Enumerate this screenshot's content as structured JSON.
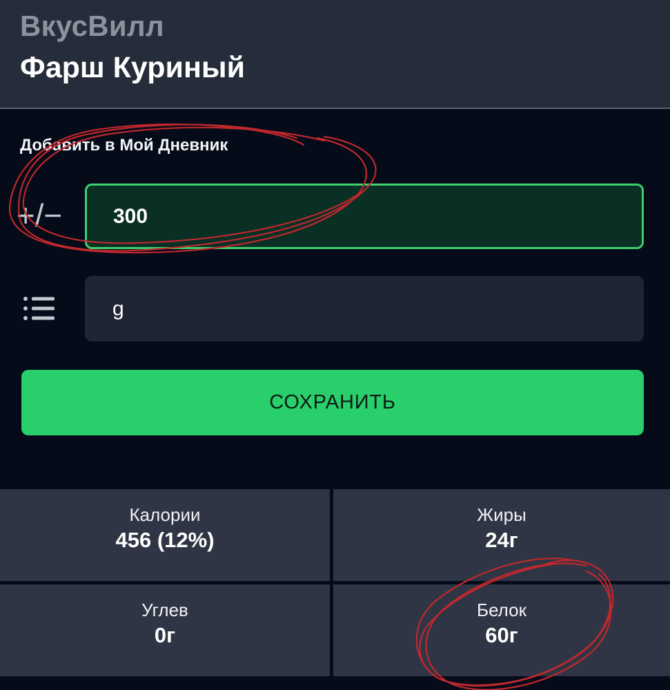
{
  "header": {
    "brand": "ВкусВилл",
    "title": "Фарш Куриный"
  },
  "add_section": {
    "label": "Добавить в Мой Дневник",
    "quantity_icon_text": "+/−",
    "quantity_value": "300",
    "unit_icon": "list-icon",
    "unit_value": "g",
    "save_label": "СОХРАНИТЬ"
  },
  "nutrition": [
    {
      "label": "Калории",
      "value": "456 (12%)"
    },
    {
      "label": "Жиры",
      "value": "24г"
    },
    {
      "label": "Углев",
      "value": "0г"
    },
    {
      "label": "Белок",
      "value": "60г"
    }
  ],
  "colors": {
    "header_bg": "#262d3a",
    "page_bg": "#050b18",
    "accent_green": "#29cf6b",
    "qty_field_bg": "#0a2f25",
    "annotation_red": "#c0282d"
  }
}
